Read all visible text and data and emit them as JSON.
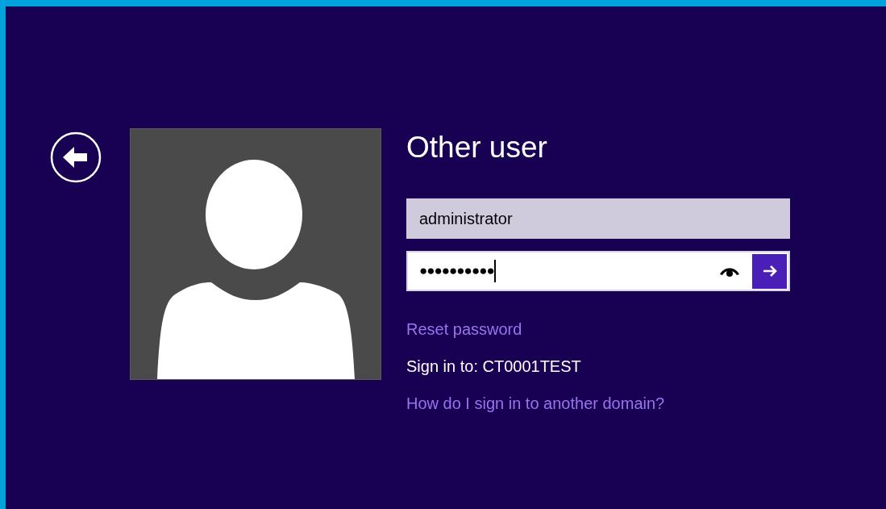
{
  "title": "Other user",
  "username": {
    "value": "administrator"
  },
  "password": {
    "value": "●●●●●●●●●●"
  },
  "links": [
    {
      "kind": "link",
      "text": "Reset password"
    },
    {
      "kind": "info",
      "text": "Sign in to: CT0001TEST"
    },
    {
      "kind": "link",
      "text": "How do I sign in to another domain?"
    }
  ]
}
